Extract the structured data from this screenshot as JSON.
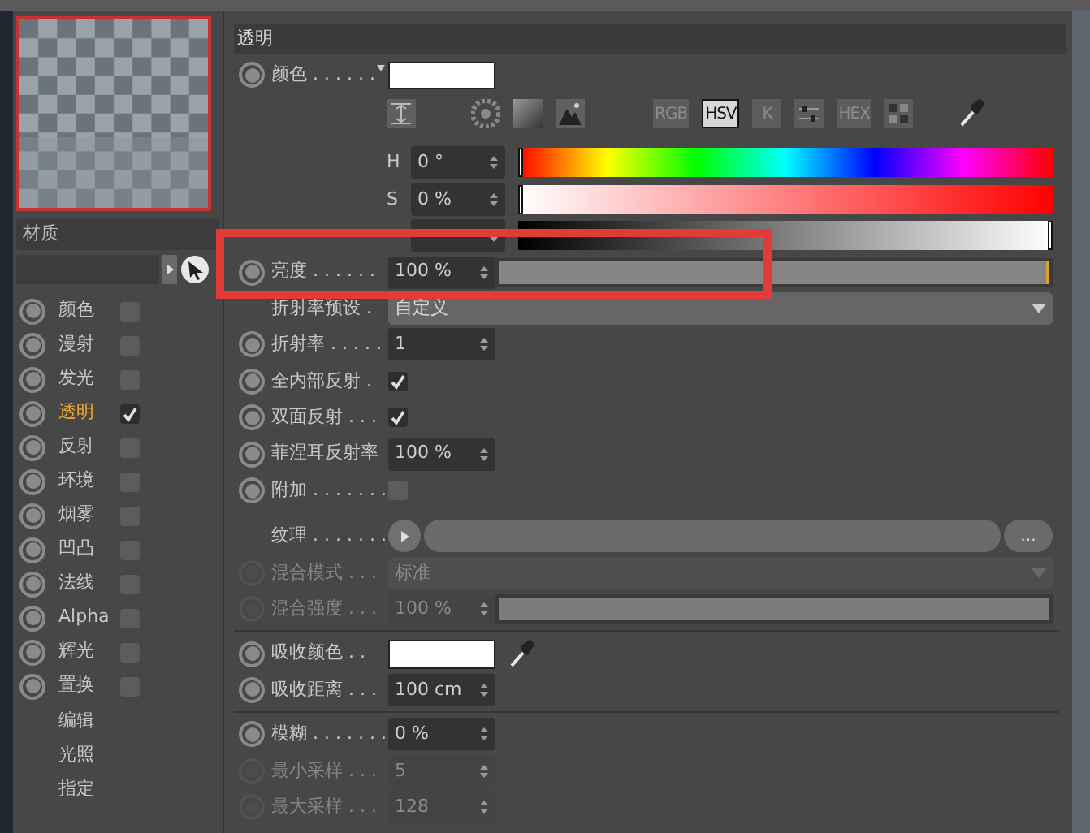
{
  "preview": {
    "selected": true
  },
  "material_name": "材质",
  "channels": [
    {
      "label": "颜色",
      "checked": false,
      "selected": false
    },
    {
      "label": "漫射",
      "checked": false,
      "selected": false
    },
    {
      "label": "发光",
      "checked": false,
      "selected": false
    },
    {
      "label": "透明",
      "checked": true,
      "selected": true
    },
    {
      "label": "反射",
      "checked": false,
      "selected": false
    },
    {
      "label": "环境",
      "checked": false,
      "selected": false
    },
    {
      "label": "烟雾",
      "checked": false,
      "selected": false
    },
    {
      "label": "凹凸",
      "checked": false,
      "selected": false
    },
    {
      "label": "法线",
      "checked": false,
      "selected": false
    },
    {
      "label": "Alpha",
      "checked": false,
      "selected": false
    },
    {
      "label": "辉光",
      "checked": false,
      "selected": false
    },
    {
      "label": "置换",
      "checked": false,
      "selected": false
    }
  ],
  "extra_items": [
    "编辑",
    "光照",
    "指定"
  ],
  "section_title": "透明",
  "color": {
    "label": "颜色 . . . . . .",
    "color": "#ffffff"
  },
  "color_modes": [
    {
      "label": "RGB",
      "selected": false
    },
    {
      "label": "HSV",
      "selected": true
    },
    {
      "label": "K",
      "selected": false
    },
    {
      "label": "HEX",
      "selected": false
    }
  ],
  "hsv": [
    {
      "kind": "hue",
      "label": "H",
      "value": "0 °",
      "level": 0
    },
    {
      "kind": "saturation",
      "label": "S",
      "value": "0 %",
      "level": 0
    },
    {
      "kind": "value",
      "level": 1
    }
  ],
  "properties": [
    {
      "kind": "slider",
      "label": "亮度 . . . . . .",
      "value": "100 %",
      "level": 1,
      "disabled": false,
      "highlighted": true
    },
    {
      "kind": "preset",
      "label": "折射率预设 .",
      "value": "自定义",
      "disabled": false
    },
    {
      "kind": "number",
      "label": "折射率 . . . . .",
      "value": "1",
      "disabled": false
    },
    {
      "kind": "check",
      "label": "全内部反射 .",
      "checked": true,
      "disabled": false
    },
    {
      "kind": "check",
      "label": "双面反射 . . .",
      "checked": true,
      "disabled": false
    },
    {
      "kind": "number",
      "label": "菲涅耳反射率",
      "value": "100 %",
      "disabled": false
    },
    {
      "kind": "check",
      "label": "附加 . . . . . . .",
      "checked": false,
      "disabled": false
    },
    {
      "kind": "spacer"
    },
    {
      "kind": "texture",
      "label": "纹理 . . . . . . .",
      "more": "...",
      "disabled": false
    },
    {
      "kind": "dropdown",
      "label": "混合模式 . . .",
      "value": "标准",
      "disabled": true
    },
    {
      "kind": "slider",
      "label": "混合强度 . . .",
      "value": "100 %",
      "level": 1,
      "disabled": true
    },
    {
      "kind": "separator"
    },
    {
      "kind": "color",
      "label": "吸收颜色 . .",
      "color": "#ffffff",
      "disabled": false
    },
    {
      "kind": "number",
      "label": "吸收距离 . . .",
      "value": "100 cm",
      "disabled": false
    },
    {
      "kind": "separator"
    },
    {
      "kind": "number",
      "label": "模糊 . . . . . . .",
      "value": "0 %",
      "disabled": false
    },
    {
      "kind": "number",
      "label": "最小采样 . . .",
      "value": "5",
      "disabled": true
    },
    {
      "kind": "number",
      "label": "最大采样 . . .",
      "value": "128",
      "disabled": true
    }
  ]
}
